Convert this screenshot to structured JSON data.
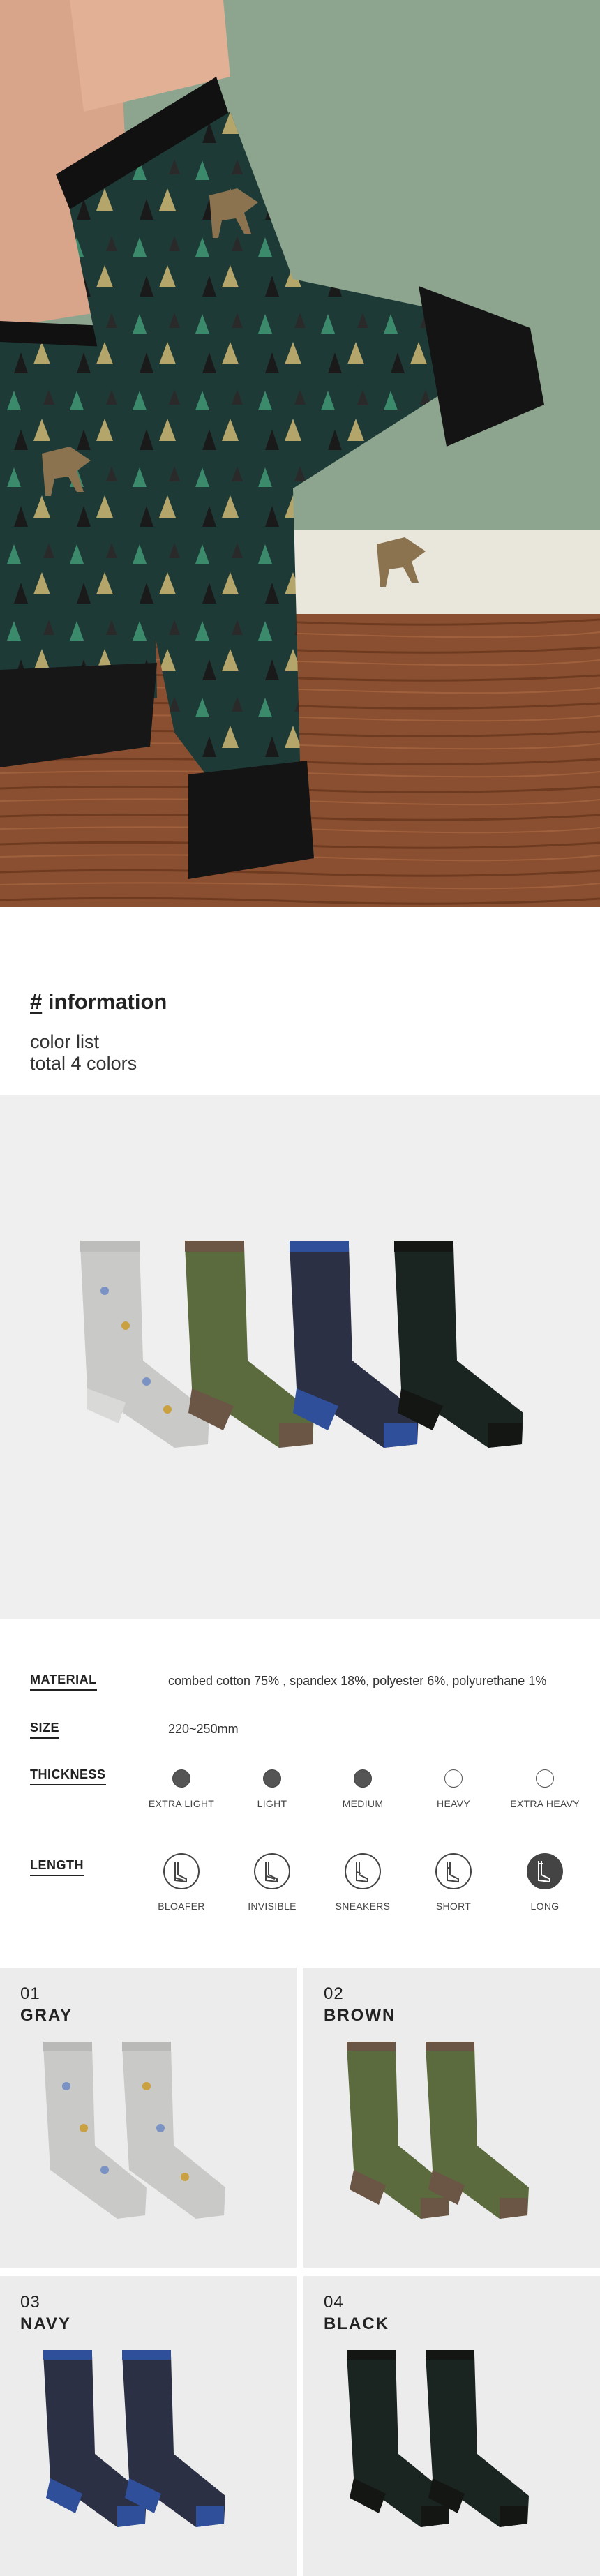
{
  "hero": {
    "alt": "Legs wearing green reindeer pattern crew socks on a wooden floor"
  },
  "info": {
    "hash": "#",
    "heading": "information",
    "color_list": "color list",
    "total": "total 4 colors"
  },
  "specs": {
    "material": {
      "label": "MATERIAL",
      "value": "combed cotton 75% , spandex 18%, polyester 6%, polyurethane 1%"
    },
    "size": {
      "label": "SIZE",
      "value": "220~250mm"
    },
    "thickness": {
      "label": "THICKNESS",
      "options": [
        {
          "label": "EXTRA LIGHT",
          "selected": true
        },
        {
          "label": "LIGHT",
          "selected": true
        },
        {
          "label": "MEDIUM",
          "selected": true
        },
        {
          "label": "HEAVY",
          "selected": false
        },
        {
          "label": "EXTRA HEAVY",
          "selected": false
        }
      ]
    },
    "length": {
      "label": "LENGTH",
      "options": [
        {
          "label": "BLOAFER",
          "selected": false
        },
        {
          "label": "INVISIBLE",
          "selected": false
        },
        {
          "label": "SNEAKERS",
          "selected": false
        },
        {
          "label": "SHORT",
          "selected": false
        },
        {
          "label": "LONG",
          "selected": true
        }
      ]
    }
  },
  "colors": [
    {
      "num": "01",
      "name": "GRAY",
      "body": "#c9c9c7",
      "cuff": "#b9b9b7",
      "accent": "#d9d9d7"
    },
    {
      "num": "02",
      "name": "BROWN",
      "body": "#5b6b3e",
      "cuff": "#6b5646",
      "accent": "#6b5646"
    },
    {
      "num": "03",
      "name": "NAVY",
      "body": "#2b3045",
      "cuff": "#2f4f9a",
      "accent": "#2f4f9a"
    },
    {
      "num": "04",
      "name": "BLACK",
      "body": "#1a2421",
      "cuff": "#141614",
      "accent": "#141614"
    }
  ],
  "style": {
    "hero_sock": "#1e3a36",
    "hero_heel": "#171717",
    "wall": "#8da58f",
    "floor": "#8a4f30",
    "thickness_fill": "#555555"
  }
}
